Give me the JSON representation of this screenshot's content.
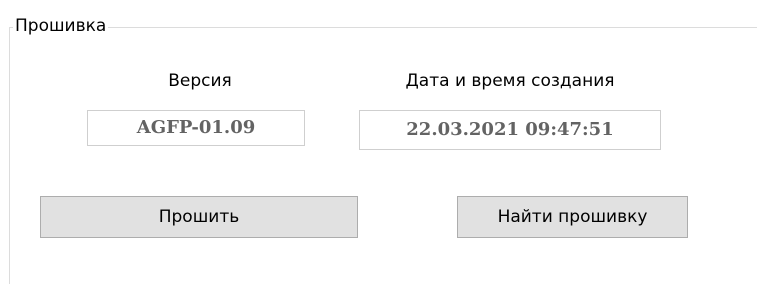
{
  "firmware_group": {
    "title": "Прошивка",
    "version": {
      "label": "Версия",
      "value": "AGFP-01.09"
    },
    "build_datetime": {
      "label": "Дата и время создания",
      "value": "22.03.2021 09:47:51"
    },
    "buttons": {
      "flash_label": "Прошить",
      "find_firmware_label": "Найти прошивку"
    }
  },
  "colors": {
    "background": "#ffffff",
    "frame": "#dcdcdc",
    "field_text": "#636363",
    "button_face": "#e1e1e1",
    "button_border": "#adadad"
  }
}
